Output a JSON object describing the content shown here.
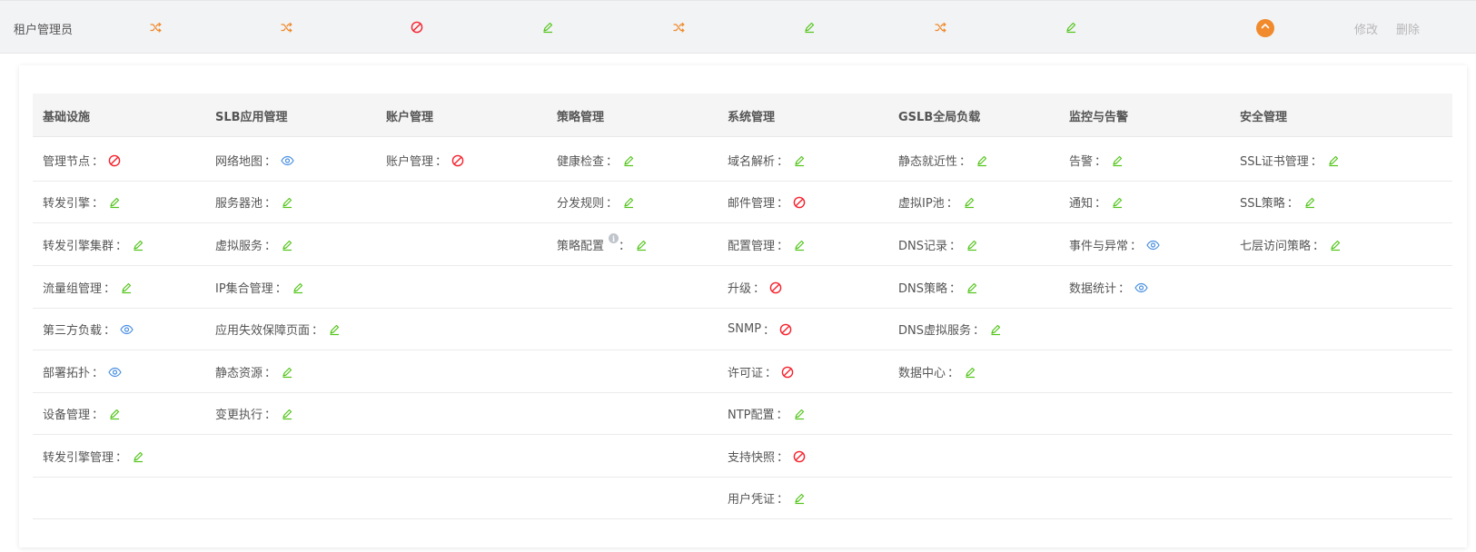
{
  "role": {
    "name": "租户管理员",
    "summary_icons": [
      "shuffle-icon",
      "shuffle-icon",
      "forbidden-icon",
      "edit-icon",
      "shuffle-icon",
      "edit-icon",
      "shuffle-icon",
      "edit-icon"
    ],
    "edit_label": "修改",
    "delete_label": "删除"
  },
  "colors": {
    "edit": "#52c41a",
    "forbidden": "#f5222d",
    "view": "#4a90e2",
    "shuffle": "#f08a2c",
    "accent": "#f08a2c"
  },
  "columns": [
    {
      "title": "基础设施",
      "items": [
        {
          "label": "管理节点",
          "icon": "forbidden-icon"
        },
        {
          "label": "转发引擎",
          "icon": "edit-icon"
        },
        {
          "label": "转发引擎集群",
          "icon": "edit-icon"
        },
        {
          "label": "流量组管理",
          "icon": "edit-icon"
        },
        {
          "label": "第三方负载",
          "icon": "view-icon"
        },
        {
          "label": "部署拓扑",
          "icon": "view-icon"
        },
        {
          "label": "设备管理",
          "icon": "edit-icon"
        },
        {
          "label": "转发引擎管理",
          "icon": "edit-icon"
        }
      ]
    },
    {
      "title": "SLB应用管理",
      "items": [
        {
          "label": "网络地图",
          "icon": "view-icon"
        },
        {
          "label": "服务器池",
          "icon": "edit-icon"
        },
        {
          "label": "虚拟服务",
          "icon": "edit-icon"
        },
        {
          "label": "IP集合管理",
          "icon": "edit-icon"
        },
        {
          "label": "应用失效保障页面",
          "icon": "edit-icon"
        },
        {
          "label": "静态资源",
          "icon": "edit-icon"
        },
        {
          "label": "变更执行",
          "icon": "edit-icon"
        }
      ]
    },
    {
      "title": "账户管理",
      "items": [
        {
          "label": "账户管理",
          "icon": "forbidden-icon"
        }
      ]
    },
    {
      "title": "策略管理",
      "items": [
        {
          "label": "健康检查",
          "icon": "edit-icon"
        },
        {
          "label": "分发规则",
          "icon": "edit-icon"
        },
        {
          "label": "策略配置",
          "icon": "edit-icon",
          "info": true
        }
      ]
    },
    {
      "title": "系统管理",
      "items": [
        {
          "label": "域名解析",
          "icon": "edit-icon"
        },
        {
          "label": "邮件管理",
          "icon": "forbidden-icon"
        },
        {
          "label": "配置管理",
          "icon": "edit-icon"
        },
        {
          "label": "升级",
          "icon": "forbidden-icon"
        },
        {
          "label": "SNMP",
          "icon": "forbidden-icon"
        },
        {
          "label": "许可证",
          "icon": "forbidden-icon"
        },
        {
          "label": "NTP配置",
          "icon": "edit-icon"
        },
        {
          "label": "支持快照",
          "icon": "forbidden-icon"
        },
        {
          "label": "用户凭证",
          "icon": "edit-icon"
        }
      ]
    },
    {
      "title": "GSLB全局负载",
      "items": [
        {
          "label": "静态就近性",
          "icon": "edit-icon"
        },
        {
          "label": "虚拟IP池",
          "icon": "edit-icon"
        },
        {
          "label": "DNS记录",
          "icon": "edit-icon"
        },
        {
          "label": "DNS策略",
          "icon": "edit-icon"
        },
        {
          "label": "DNS虚拟服务",
          "icon": "edit-icon"
        },
        {
          "label": "数据中心",
          "icon": "edit-icon"
        }
      ]
    },
    {
      "title": "监控与告警",
      "items": [
        {
          "label": "告警",
          "icon": "edit-icon"
        },
        {
          "label": "通知",
          "icon": "edit-icon"
        },
        {
          "label": "事件与异常",
          "icon": "view-icon"
        },
        {
          "label": "数据统计",
          "icon": "view-icon"
        }
      ]
    },
    {
      "title": "安全管理",
      "items": [
        {
          "label": "SSL证书管理",
          "icon": "edit-icon"
        },
        {
          "label": "SSL策略",
          "icon": "edit-icon"
        },
        {
          "label": "七层访问策略",
          "icon": "edit-icon"
        }
      ]
    }
  ],
  "separator": "："
}
